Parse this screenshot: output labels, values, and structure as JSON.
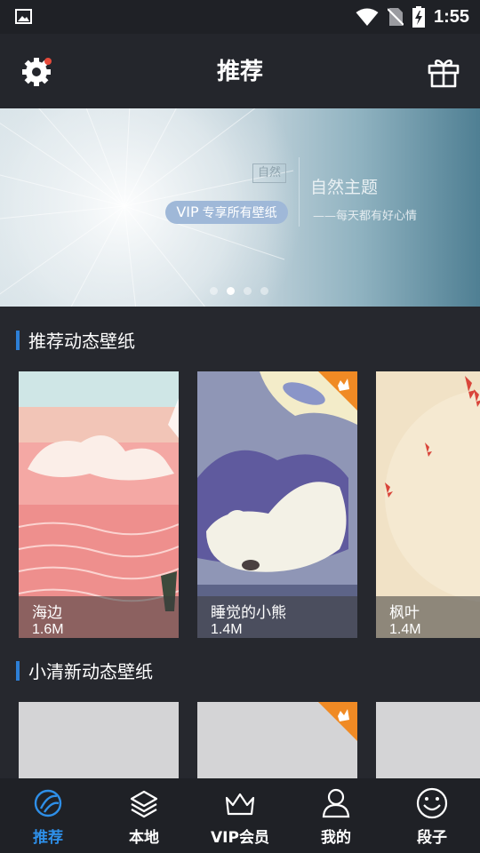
{
  "status_bar": {
    "time": "1:55"
  },
  "header": {
    "title": "推荐"
  },
  "banner": {
    "tag": "自然",
    "vip_prefix": "VIP",
    "vip_text": "专享所有壁纸",
    "title": "自然主题",
    "subtitle": "——每天都有好心情",
    "active_dot": 1,
    "dot_count": 4
  },
  "sections": [
    {
      "title": "推荐动态壁纸",
      "items": [
        {
          "name": "海边",
          "size": "1.6M",
          "vip": false
        },
        {
          "name": "睡觉的小熊",
          "size": "1.4M",
          "vip": true
        },
        {
          "name": "枫叶",
          "size": "1.4M",
          "vip": false
        }
      ]
    },
    {
      "title": "小清新动态壁纸",
      "items": [
        {
          "vip": false
        },
        {
          "vip": true
        },
        {
          "vip": false
        }
      ]
    }
  ],
  "bottom_nav": [
    {
      "label": "推荐",
      "icon": "recommend-planet-icon",
      "active": true
    },
    {
      "label": "本地",
      "icon": "layers-icon",
      "active": false
    },
    {
      "label": "VIP会员",
      "icon": "crown-icon",
      "active": false
    },
    {
      "label": "我的",
      "icon": "user-icon",
      "active": false
    },
    {
      "label": "段子",
      "icon": "smiley-icon",
      "active": false
    }
  ],
  "colors": {
    "accent": "#2e8fe8",
    "vip_badge": "#f08a24",
    "notification_dot": "#e64a3b"
  }
}
